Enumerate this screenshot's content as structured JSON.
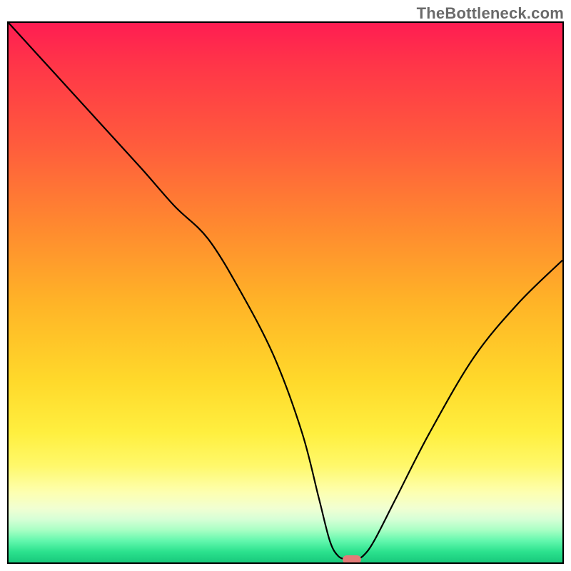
{
  "watermark": "TheBottleneck.com",
  "chart_data": {
    "type": "line",
    "title": "",
    "xlabel": "",
    "ylabel": "",
    "xlim": [
      0,
      100
    ],
    "ylim": [
      0,
      100
    ],
    "grid": false,
    "legend": false,
    "background": {
      "kind": "vertical-gradient",
      "stops": [
        {
          "pos": 0,
          "color": "#ff1d52"
        },
        {
          "pos": 22,
          "color": "#ff5a3d"
        },
        {
          "pos": 52,
          "color": "#ffb427"
        },
        {
          "pos": 76,
          "color": "#ffef3f"
        },
        {
          "pos": 90,
          "color": "#f1ffd2"
        },
        {
          "pos": 100,
          "color": "#18c97c"
        }
      ]
    },
    "series": [
      {
        "name": "bottleneck-curve",
        "color": "#000000",
        "x": [
          0,
          8,
          16,
          24,
          30,
          36,
          42,
          48,
          53,
          56,
          58,
          59.5,
          61,
          62.5,
          64,
          66,
          70,
          76,
          84,
          92,
          100
        ],
        "y": [
          100,
          91,
          82,
          73,
          66,
          60,
          50,
          38,
          24,
          12,
          4,
          1.2,
          0.6,
          0.6,
          1.2,
          4,
          12,
          24,
          38,
          48,
          56
        ]
      }
    ],
    "marker": {
      "name": "optimum-pill",
      "shape": "rounded-rect",
      "color": "#e37b78",
      "x": 62,
      "y": 0.5
    }
  }
}
